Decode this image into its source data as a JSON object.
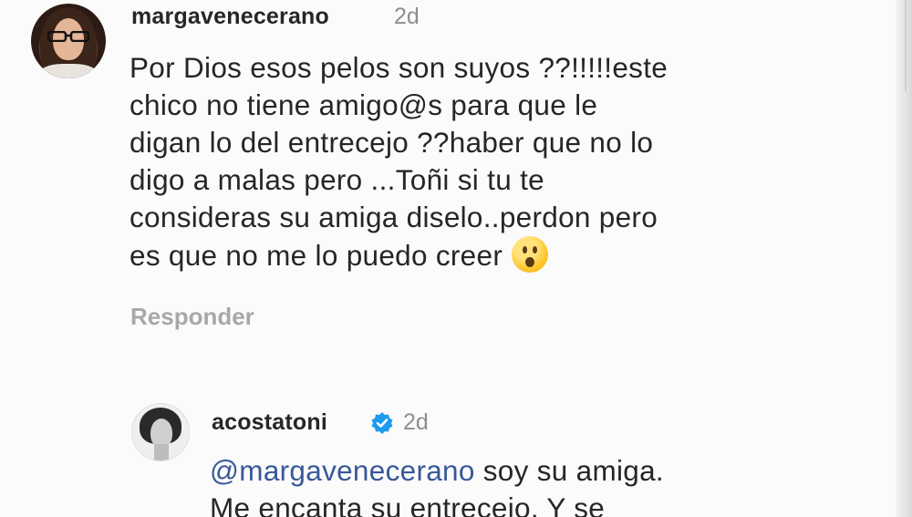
{
  "comment": {
    "username": "margavenecerano",
    "time": "2d",
    "lines": [
      "Por Dios esos pelos son suyos ??!!!!!este",
      "chico no tiene amigo@s para que le",
      "digan lo del entrecejo ??haber que no lo",
      "digo a malas pero ...Toñi si tu te",
      "consideras su amiga diselo..perdon pero",
      "es que no me lo puedo creer"
    ],
    "emoji": "hushed-face-emoji",
    "reply_label": "Responder"
  },
  "reply": {
    "username": "acostatoni",
    "verified_icon": "verified-badge-icon",
    "time": "2d",
    "mention": "@margavenecerano",
    "line1_rest": " soy su amiga.",
    "line2": "Me encanta su entrecejo. Y se"
  },
  "colors": {
    "mention": "#385898",
    "verified": "#1d9bf0",
    "muted": "#8e8e8e",
    "text": "#262626"
  }
}
